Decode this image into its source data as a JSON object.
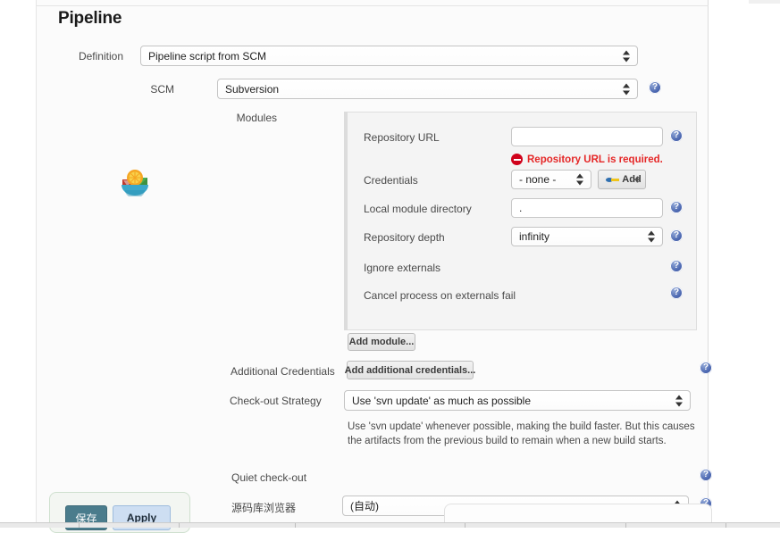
{
  "page": {
    "title": "Pipeline"
  },
  "definition": {
    "label": "Definition",
    "value": "Pipeline script from SCM"
  },
  "scm": {
    "label": "SCM",
    "value": "Subversion"
  },
  "modules": {
    "label": "Modules",
    "repository_url": {
      "label": "Repository URL",
      "value": "",
      "error": "Repository URL is required."
    },
    "credentials": {
      "label": "Credentials",
      "value": "- none -",
      "add_button": "Add"
    },
    "local_module_directory": {
      "label": "Local module directory",
      "value": "."
    },
    "repository_depth": {
      "label": "Repository depth",
      "value": "infinity"
    },
    "ignore_externals": {
      "label": "Ignore externals"
    },
    "cancel_process_on_externals_fail": {
      "label": "Cancel process on externals fail"
    },
    "add_module_button": "Add module..."
  },
  "additional_credentials": {
    "label": "Additional Credentials",
    "button": "Add additional credentials..."
  },
  "checkout_strategy": {
    "label": "Check-out Strategy",
    "value": "Use 'svn update' as much as possible",
    "description": "Use 'svn update' whenever possible, making the build faster. But this causes the artifacts from the previous build to remain when a new build starts."
  },
  "quiet_checkout": {
    "label": "Quiet check-out"
  },
  "repository_browser": {
    "label": "源码库浏览器",
    "value": "(自动)"
  },
  "footer": {
    "save_label": "保存",
    "apply_label": "Apply"
  },
  "icons": {
    "help": "?",
    "bowl": "fruit-bowl-icon"
  },
  "colors": {
    "error_red": "#e52727",
    "help_blue": "#4a66b0",
    "save_teal": "#4a7c8c",
    "apply_blue": "#cddef2",
    "panel_grey": "#f4f4f4"
  }
}
